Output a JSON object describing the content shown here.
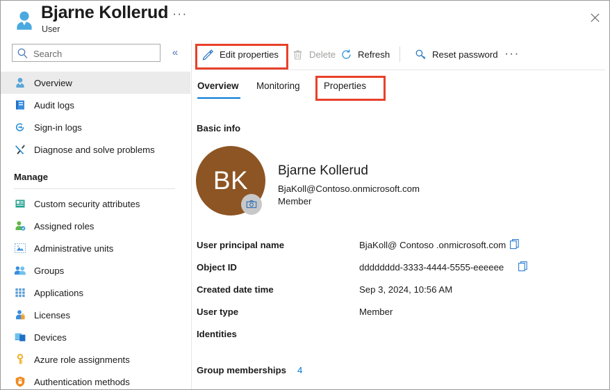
{
  "header": {
    "title": "Bjarne Kollerud",
    "subtitle": "User",
    "ellipsis": "···",
    "user_icon": "user-icon",
    "close_icon": "close-icon"
  },
  "sidebar": {
    "search": {
      "placeholder": "Search",
      "value": "",
      "icon": "search-icon"
    },
    "collapse_icon": "«",
    "items": [
      {
        "label": "Overview",
        "icon": "user-icon",
        "selected": true
      },
      {
        "label": "Audit logs",
        "icon": "book-icon",
        "selected": false
      },
      {
        "label": "Sign-in logs",
        "icon": "sign-in-icon",
        "selected": false
      },
      {
        "label": "Diagnose and solve problems",
        "icon": "wrench-icon",
        "selected": false
      }
    ],
    "group_label": "Manage",
    "manage_items": [
      {
        "label": "Custom security attributes",
        "icon": "attribute-card-icon"
      },
      {
        "label": "Assigned roles",
        "icon": "assigned-roles-icon"
      },
      {
        "label": "Administrative units",
        "icon": "administrative-units-icon"
      },
      {
        "label": "Groups",
        "icon": "groups-icon"
      },
      {
        "label": "Applications",
        "icon": "applications-grid-icon"
      },
      {
        "label": "Licenses",
        "icon": "licenses-icon"
      },
      {
        "label": "Devices",
        "icon": "devices-icon"
      },
      {
        "label": "Azure role assignments",
        "icon": "key-icon"
      },
      {
        "label": "Authentication methods",
        "icon": "shield-lock-icon"
      }
    ]
  },
  "toolbar": {
    "edit_properties": {
      "label": "Edit properties",
      "icon": "pencil-icon",
      "disabled": false
    },
    "delete": {
      "label": "Delete",
      "icon": "trash-icon",
      "disabled": true
    },
    "refresh": {
      "label": "Refresh",
      "icon": "refresh-icon",
      "disabled": false
    },
    "reset_password": {
      "label": "Reset password",
      "icon": "key-search-icon",
      "disabled": false
    },
    "ellipsis": "···"
  },
  "tabs": [
    {
      "label": "Overview",
      "active": true
    },
    {
      "label": "Monitoring",
      "active": false
    },
    {
      "label": "Properties",
      "active": false
    }
  ],
  "main": {
    "section_title": "Basic info",
    "identity": {
      "initials": "BK",
      "name": "Bjarne Kollerud",
      "email": "BjaKoll@Contoso.onmicrosoft.com",
      "user_type": "Member",
      "camera_icon": "camera-icon",
      "avatar_color": "#8d5524"
    },
    "properties": [
      {
        "label": "User principal name",
        "value": "BjaKoll@ Contoso .onmicrosoft.com",
        "copy": true
      },
      {
        "label": "Object ID",
        "value": "dddddddd-3333-4444-5555-eeeeee",
        "copy": true
      },
      {
        "label": "Created date time",
        "value": "Sep 3, 2024, 10:56 AM",
        "copy": false
      },
      {
        "label": "User type",
        "value": "Member",
        "copy": false
      },
      {
        "label": "Identities",
        "value": "",
        "copy": false
      }
    ],
    "group_memberships": {
      "label": "Group memberships",
      "count": "4"
    }
  },
  "annotations": {
    "accent_color": "#e8402a",
    "highlight_edit_properties": true,
    "highlight_properties_tab": true
  }
}
